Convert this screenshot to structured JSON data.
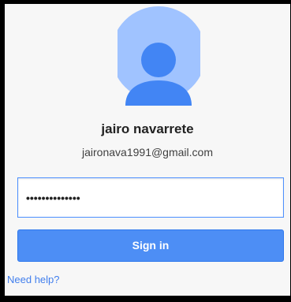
{
  "user": {
    "name": "jairo navarrete",
    "email": "jaironava1991@gmail.com"
  },
  "password": {
    "value": "••••••••••••••"
  },
  "signin": {
    "label": "Sign in"
  },
  "help": {
    "label": "Need help?"
  },
  "colors": {
    "accent": "#4d8ef5",
    "link": "#427fed",
    "avatar_bg": "#a0c3ff",
    "avatar_figure": "#4285f4"
  },
  "icons": {
    "avatar": "person-silhouette-icon"
  }
}
